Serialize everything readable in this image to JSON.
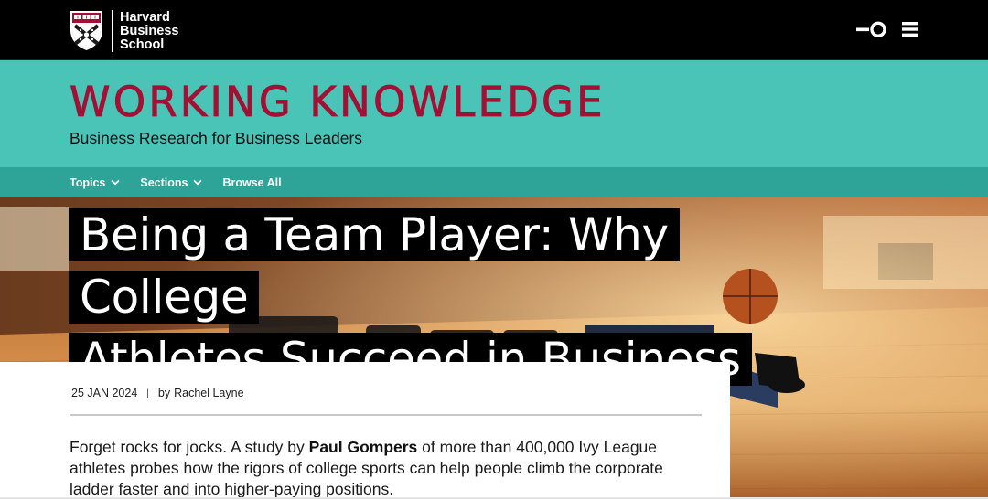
{
  "header": {
    "logo_lines": [
      "Harvard",
      "Business",
      "School"
    ],
    "icons": [
      "key-icon",
      "menu-icon"
    ]
  },
  "masthead": {
    "title": "WORKING KNOWLEDGE",
    "subtitle": "Business Research for Business Leaders"
  },
  "nav": {
    "items": [
      {
        "label": "Topics",
        "has_dropdown": true
      },
      {
        "label": "Sections",
        "has_dropdown": true
      },
      {
        "label": "Browse All",
        "has_dropdown": false
      }
    ]
  },
  "article": {
    "headline_line1": "Being a Team Player: Why College",
    "headline_line2": "Athletes Succeed in Business",
    "date": "25 JAN 2024",
    "separator": "|",
    "author_prefix": "by",
    "author": "Rachel Layne",
    "dek_part1": "Forget rocks for jocks. A study by ",
    "dek_bold": "Paul Gompers",
    "dek_part2": " of more than 400,000 Ivy League athletes probes how the rigors of college sports can help people climb the corporate ladder faster and into higher-paying positions."
  },
  "colors": {
    "topbar": "#000000",
    "masthead": "#4ac4b7",
    "nav": "#2ea397",
    "brand_crimson": "#a41034"
  }
}
